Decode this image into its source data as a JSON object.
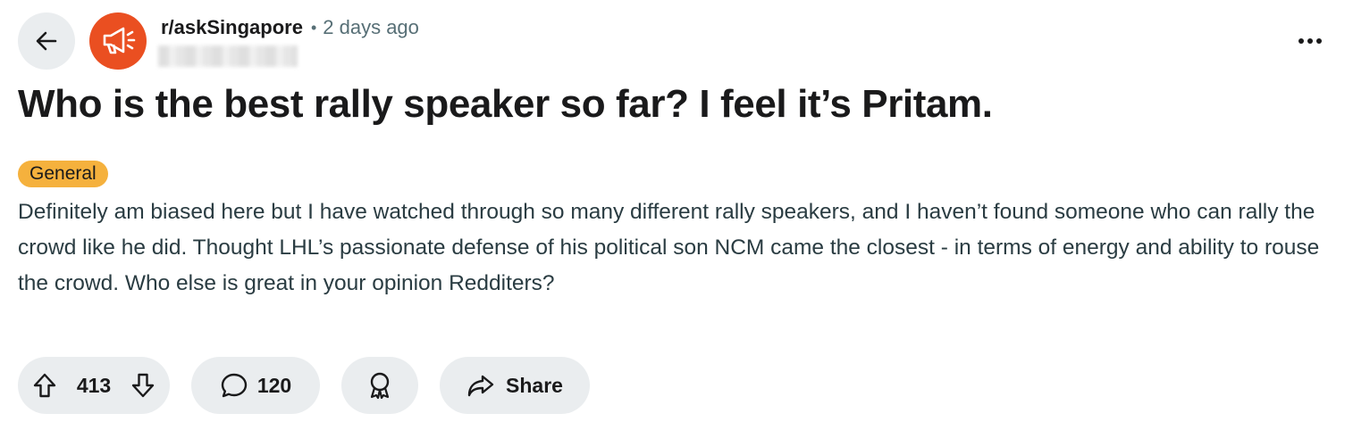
{
  "post": {
    "subreddit": "r/askSingapore",
    "separator": "•",
    "time_ago": "2 days ago",
    "title": "Who is the best rally speaker so far? I feel it’s Pritam.",
    "flair": "General",
    "body": "Definitely am biased here but I have watched through so many different rally speakers, and I haven’t found someone who can rally the crowd like he did. Thought LHL’s passionate defense of his political son NCM came the closest - in terms of energy and ability to rouse the crowd. Who else is great in your opinion Redditers?"
  },
  "actions": {
    "upvotes": "413",
    "comments": "120",
    "share_label": "Share"
  },
  "icons": {
    "back": "arrow-left-icon",
    "avatar": "megaphone-icon",
    "more": "ellipsis-icon",
    "upvote": "arrow-up-icon",
    "downvote": "arrow-down-icon",
    "comment": "speech-bubble-icon",
    "award": "award-ribbon-icon",
    "share": "share-arrow-icon"
  },
  "colors": {
    "avatar_bg": "#ea4f21",
    "flair_bg": "#f5b13d",
    "button_bg": "#eaedef",
    "meta_text": "#576f76"
  }
}
